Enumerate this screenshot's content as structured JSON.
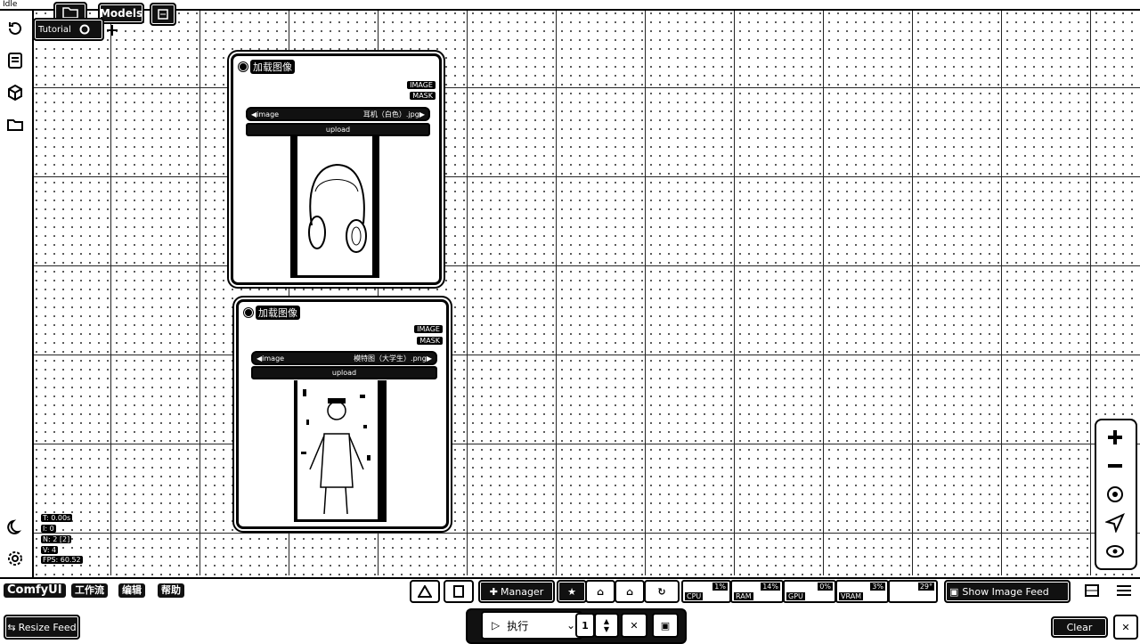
{
  "status": "Idle",
  "top_buttons": {
    "models_label": "Models",
    "tutorial_label": "Tutorial"
  },
  "nodes": [
    {
      "title": "加载图像",
      "outputs": [
        "IMAGE",
        "MASK"
      ],
      "combo_name": "image",
      "combo_value": "耳机（白色）.jpg",
      "upload_label": "upload"
    },
    {
      "title": "加载图像",
      "outputs": [
        "IMAGE",
        "MASK"
      ],
      "combo_name": "image",
      "combo_value": "模特图（大学生）.png",
      "upload_label": "upload"
    }
  ],
  "info_panel": {
    "t": "T: 0.00s",
    "i": "I: 0",
    "n": "N: 2 [2]",
    "v": "V: 4",
    "fps": "FPS: 60.52"
  },
  "menu": {
    "brand": "ComfyUI",
    "items": [
      "工作流",
      "编辑",
      "帮助"
    ]
  },
  "toolbar": {
    "manager_label": "Manager",
    "show_image_feed_label": "Show Image Feed",
    "resize_feed_label": "Resize Feed",
    "run_label": "执行",
    "queue_count": "1",
    "clear_label": "Clear"
  },
  "stats": [
    {
      "label": "CPU",
      "percent": "1%"
    },
    {
      "label": "RAM",
      "percent": "14%"
    },
    {
      "label": "GPU",
      "percent": "0%"
    },
    {
      "label": "VRAM",
      "percent": "3%"
    },
    {
      "label": "",
      "percent": "29°"
    }
  ],
  "colors": {
    "foreground": "#000000",
    "background": "#ffffff"
  }
}
